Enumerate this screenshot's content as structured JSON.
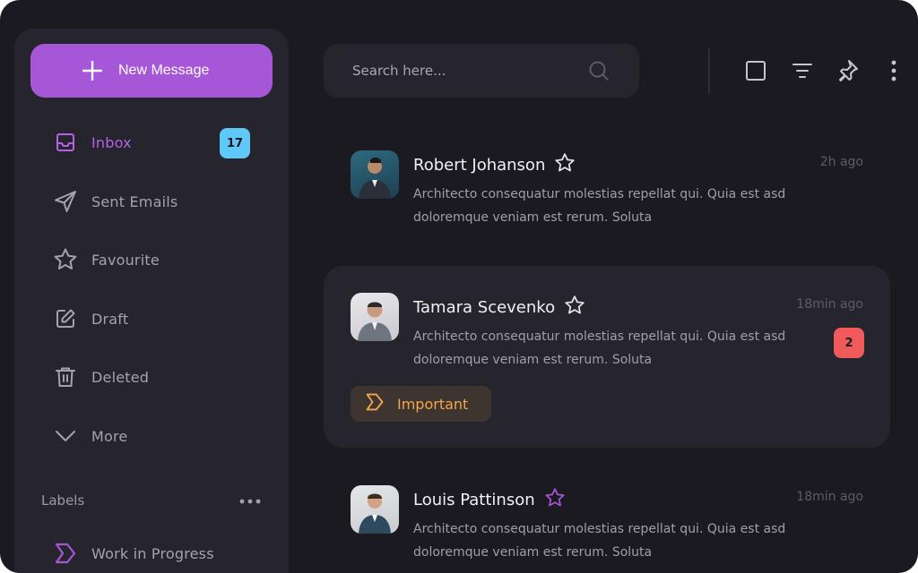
{
  "sidebar": {
    "new_message_label": "New Message",
    "items": [
      {
        "label": "Inbox",
        "icon": "inbox-icon",
        "active": true
      },
      {
        "label": "Sent Emails",
        "icon": "send-icon"
      },
      {
        "label": "Favourite",
        "icon": "star-icon"
      },
      {
        "label": "Draft",
        "icon": "edit-icon"
      },
      {
        "label": "Deleted",
        "icon": "trash-icon"
      },
      {
        "label": "More",
        "icon": "chevron-down-icon"
      }
    ],
    "inbox_count": "17",
    "labels_heading": "Labels",
    "labels": [
      {
        "label": "Work in Progress",
        "icon": "tag-icon",
        "color": "#a557d8"
      }
    ]
  },
  "search": {
    "placeholder": "Search here..."
  },
  "toolbar": [
    "checkbox-icon",
    "filter-icon",
    "pin-icon",
    "more-vertical-icon"
  ],
  "messages": [
    {
      "sender": "Robert Johanson",
      "time": "2h ago",
      "preview_line1": "Architecto consequatur molestias repellat qui. Quia est asd",
      "preview_line2": "doloremque veniam est rerum. Soluta",
      "starred": false
    },
    {
      "sender": "Tamara Scevenko",
      "time": "18min ago",
      "preview_line1": "Architecto consequatur molestias repellat qui. Quia est asd",
      "preview_line2": "doloremque veniam est rerum. Soluta",
      "unread": "2",
      "tag": "Important",
      "starred": false
    },
    {
      "sender": "Louis Pattinson",
      "time": "18min ago",
      "preview_line1": "Architecto consequatur molestias repellat qui. Quia est asd",
      "preview_line2": "doloremque veniam est rerum. Soluta",
      "starred": true
    }
  ],
  "colors": {
    "accent": "#a557d8",
    "badge_blue": "#5ec8f8",
    "badge_red": "#f05a5a",
    "important": "#f2a64a",
    "background": "#1b1a21",
    "panel": "#26252d"
  }
}
